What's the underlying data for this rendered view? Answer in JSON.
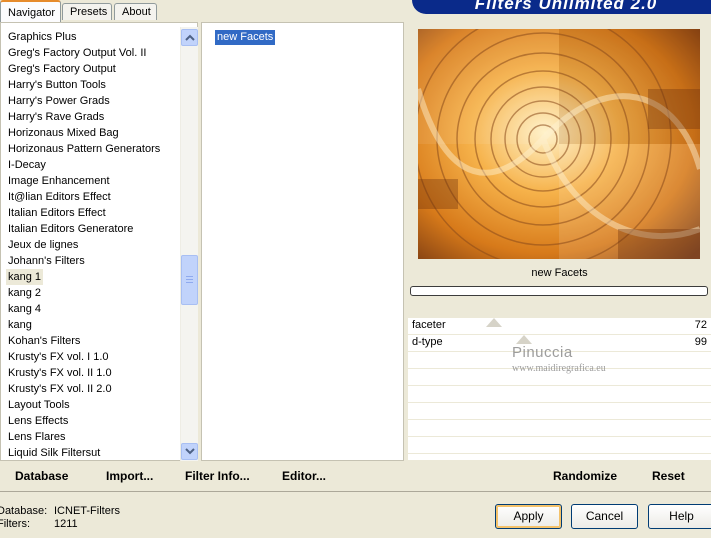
{
  "tabs": [
    {
      "label": "Navigator",
      "active": true
    },
    {
      "label": "Presets",
      "active": false
    },
    {
      "label": "About",
      "active": false
    }
  ],
  "banner": {
    "title": "Filters Unlimited 2.0"
  },
  "categories": [
    "Graphics Plus",
    "Greg's Factory Output Vol. II",
    "Greg's Factory Output",
    "Harry's Button Tools",
    "Harry's Power Grads",
    "Harry's Rave Grads",
    "Horizonaus Mixed Bag",
    "Horizonaus Pattern Generators",
    "I-Decay",
    "Image Enhancement",
    "It@lian Editors Effect",
    "Italian Editors Effect",
    "Italian Editors Generatore",
    "Jeux de lignes",
    "Johann's Filters",
    "kang 1",
    "kang 2",
    "kang 4",
    "kang",
    "Kohan's Filters",
    "Krusty's FX vol. I 1.0",
    "Krusty's FX vol. II 1.0",
    "Krusty's FX vol. II 2.0",
    "Layout Tools",
    "Lens Effects",
    "Lens Flares",
    "Liquid Silk Filtersut"
  ],
  "selected_category": "kang 1",
  "filters": [
    "new Facets"
  ],
  "selected_filter": "new Facets",
  "filter_title": "new Facets",
  "params": [
    {
      "label": "faceter",
      "value": "72"
    },
    {
      "label": "d-type",
      "value": "99"
    }
  ],
  "watermark": {
    "line1": "Pinuccia",
    "line2": "www.maidiregrafica.eu"
  },
  "actions": {
    "database": "Database",
    "import": "Import...",
    "filter_info": "Filter Info...",
    "editor": "Editor...",
    "randomize": "Randomize",
    "reset": "Reset"
  },
  "status": {
    "database_label": "Database:",
    "database_value": "ICNET-Filters",
    "filters_label": "Filters:",
    "filters_value": "1211"
  },
  "buttons": {
    "apply": "Apply",
    "cancel": "Cancel",
    "help": "Help"
  },
  "colors": {
    "selection": "#316ac5",
    "banner": "#0a2a8a",
    "panel_bg": "#ece9d8"
  }
}
